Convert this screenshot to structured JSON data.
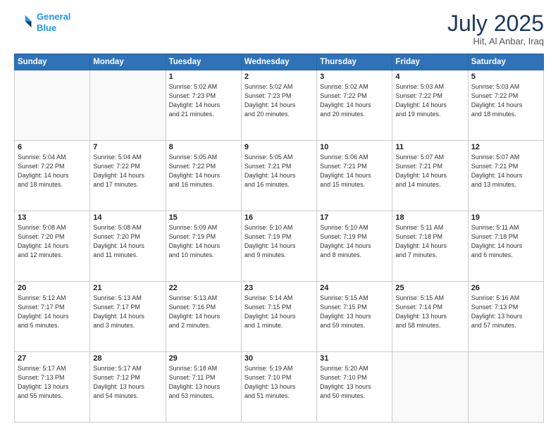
{
  "header": {
    "logo_line1": "General",
    "logo_line2": "Blue",
    "month_year": "July 2025",
    "location": "Hit, Al Anbar, Iraq"
  },
  "weekdays": [
    "Sunday",
    "Monday",
    "Tuesday",
    "Wednesday",
    "Thursday",
    "Friday",
    "Saturday"
  ],
  "weeks": [
    [
      {
        "day": "",
        "info": ""
      },
      {
        "day": "",
        "info": ""
      },
      {
        "day": "1",
        "info": "Sunrise: 5:02 AM\nSunset: 7:23 PM\nDaylight: 14 hours\nand 21 minutes."
      },
      {
        "day": "2",
        "info": "Sunrise: 5:02 AM\nSunset: 7:23 PM\nDaylight: 14 hours\nand 20 minutes."
      },
      {
        "day": "3",
        "info": "Sunrise: 5:02 AM\nSunset: 7:22 PM\nDaylight: 14 hours\nand 20 minutes."
      },
      {
        "day": "4",
        "info": "Sunrise: 5:03 AM\nSunset: 7:22 PM\nDaylight: 14 hours\nand 19 minutes."
      },
      {
        "day": "5",
        "info": "Sunrise: 5:03 AM\nSunset: 7:22 PM\nDaylight: 14 hours\nand 18 minutes."
      }
    ],
    [
      {
        "day": "6",
        "info": "Sunrise: 5:04 AM\nSunset: 7:22 PM\nDaylight: 14 hours\nand 18 minutes."
      },
      {
        "day": "7",
        "info": "Sunrise: 5:04 AM\nSunset: 7:22 PM\nDaylight: 14 hours\nand 17 minutes."
      },
      {
        "day": "8",
        "info": "Sunrise: 5:05 AM\nSunset: 7:22 PM\nDaylight: 14 hours\nand 16 minutes."
      },
      {
        "day": "9",
        "info": "Sunrise: 5:05 AM\nSunset: 7:21 PM\nDaylight: 14 hours\nand 16 minutes."
      },
      {
        "day": "10",
        "info": "Sunrise: 5:06 AM\nSunset: 7:21 PM\nDaylight: 14 hours\nand 15 minutes."
      },
      {
        "day": "11",
        "info": "Sunrise: 5:07 AM\nSunset: 7:21 PM\nDaylight: 14 hours\nand 14 minutes."
      },
      {
        "day": "12",
        "info": "Sunrise: 5:07 AM\nSunset: 7:21 PM\nDaylight: 14 hours\nand 13 minutes."
      }
    ],
    [
      {
        "day": "13",
        "info": "Sunrise: 5:08 AM\nSunset: 7:20 PM\nDaylight: 14 hours\nand 12 minutes."
      },
      {
        "day": "14",
        "info": "Sunrise: 5:08 AM\nSunset: 7:20 PM\nDaylight: 14 hours\nand 11 minutes."
      },
      {
        "day": "15",
        "info": "Sunrise: 5:09 AM\nSunset: 7:19 PM\nDaylight: 14 hours\nand 10 minutes."
      },
      {
        "day": "16",
        "info": "Sunrise: 5:10 AM\nSunset: 7:19 PM\nDaylight: 14 hours\nand 9 minutes."
      },
      {
        "day": "17",
        "info": "Sunrise: 5:10 AM\nSunset: 7:19 PM\nDaylight: 14 hours\nand 8 minutes."
      },
      {
        "day": "18",
        "info": "Sunrise: 5:11 AM\nSunset: 7:18 PM\nDaylight: 14 hours\nand 7 minutes."
      },
      {
        "day": "19",
        "info": "Sunrise: 5:11 AM\nSunset: 7:18 PM\nDaylight: 14 hours\nand 6 minutes."
      }
    ],
    [
      {
        "day": "20",
        "info": "Sunrise: 5:12 AM\nSunset: 7:17 PM\nDaylight: 14 hours\nand 5 minutes."
      },
      {
        "day": "21",
        "info": "Sunrise: 5:13 AM\nSunset: 7:17 PM\nDaylight: 14 hours\nand 3 minutes."
      },
      {
        "day": "22",
        "info": "Sunrise: 5:13 AM\nSunset: 7:16 PM\nDaylight: 14 hours\nand 2 minutes."
      },
      {
        "day": "23",
        "info": "Sunrise: 5:14 AM\nSunset: 7:15 PM\nDaylight: 14 hours\nand 1 minute."
      },
      {
        "day": "24",
        "info": "Sunrise: 5:15 AM\nSunset: 7:15 PM\nDaylight: 13 hours\nand 59 minutes."
      },
      {
        "day": "25",
        "info": "Sunrise: 5:15 AM\nSunset: 7:14 PM\nDaylight: 13 hours\nand 58 minutes."
      },
      {
        "day": "26",
        "info": "Sunrise: 5:16 AM\nSunset: 7:13 PM\nDaylight: 13 hours\nand 57 minutes."
      }
    ],
    [
      {
        "day": "27",
        "info": "Sunrise: 5:17 AM\nSunset: 7:13 PM\nDaylight: 13 hours\nand 55 minutes."
      },
      {
        "day": "28",
        "info": "Sunrise: 5:17 AM\nSunset: 7:12 PM\nDaylight: 13 hours\nand 54 minutes."
      },
      {
        "day": "29",
        "info": "Sunrise: 5:18 AM\nSunset: 7:11 PM\nDaylight: 13 hours\nand 53 minutes."
      },
      {
        "day": "30",
        "info": "Sunrise: 5:19 AM\nSunset: 7:10 PM\nDaylight: 13 hours\nand 51 minutes."
      },
      {
        "day": "31",
        "info": "Sunrise: 5:20 AM\nSunset: 7:10 PM\nDaylight: 13 hours\nand 50 minutes."
      },
      {
        "day": "",
        "info": ""
      },
      {
        "day": "",
        "info": ""
      }
    ]
  ]
}
